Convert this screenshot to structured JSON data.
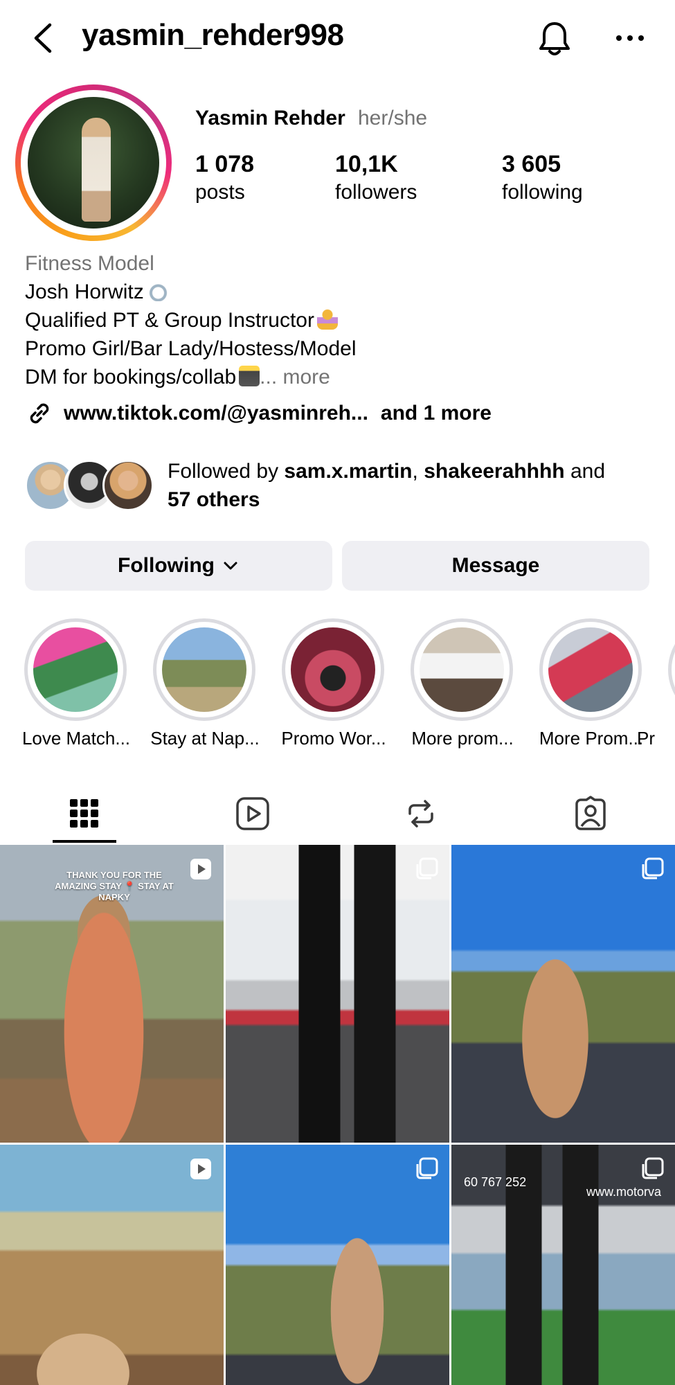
{
  "header": {
    "username": "yasmin_rehder998"
  },
  "profile": {
    "display_name": "Yasmin Rehder",
    "pronouns": "her/she",
    "stats": [
      {
        "value": "1 078",
        "label": "posts"
      },
      {
        "value": "10,1K",
        "label": "followers"
      },
      {
        "value": "3 605",
        "label": "following"
      }
    ],
    "category": "Fitness Model",
    "bio_lines": [
      "Josh Horwitz",
      "Qualified PT & Group Instructor",
      "Promo Girl/Bar Lady/Hostess/Model",
      "DM for bookings/collab"
    ],
    "bio_more": "... more",
    "link_text": "www.tiktok.com/@yasminreh...",
    "link_more": "and 1 more"
  },
  "followed_by": {
    "prefix": "Followed by ",
    "user1": "sam.x.martin",
    "separator": ", ",
    "user2": "shakeerahhhh",
    "conjunction": " and",
    "others": "57 others"
  },
  "actions": {
    "following_label": "Following",
    "message_label": "Message"
  },
  "highlights": [
    {
      "label": "Love Match..."
    },
    {
      "label": "Stay at Nap..."
    },
    {
      "label": "Promo Wor..."
    },
    {
      "label": "More prom..."
    },
    {
      "label": "More Prom..."
    },
    {
      "label": "Pr"
    }
  ],
  "tabs": [
    {
      "icon": "grid-icon",
      "active": true
    },
    {
      "icon": "reels-icon",
      "active": false
    },
    {
      "icon": "reposts-icon",
      "active": false
    },
    {
      "icon": "tagged-icon",
      "active": false
    }
  ],
  "posts": [
    {
      "type": "reel",
      "overlay_text": "THANK YOU FOR THE AMAZING STAY 📍 STAY AT NAPKY"
    },
    {
      "type": "carousel",
      "overlay_text": ""
    },
    {
      "type": "carousel",
      "overlay_text": ""
    },
    {
      "type": "reel",
      "overlay_text": ""
    },
    {
      "type": "carousel",
      "overlay_text": ""
    },
    {
      "type": "carousel",
      "overlay_text": "",
      "caption_left": "60 767 252",
      "caption_right": "www.motorva"
    }
  ],
  "colors": {
    "secondary_text": "#737373",
    "button_bg": "#efeff3",
    "highlight_ring": "#dbdbe0"
  }
}
